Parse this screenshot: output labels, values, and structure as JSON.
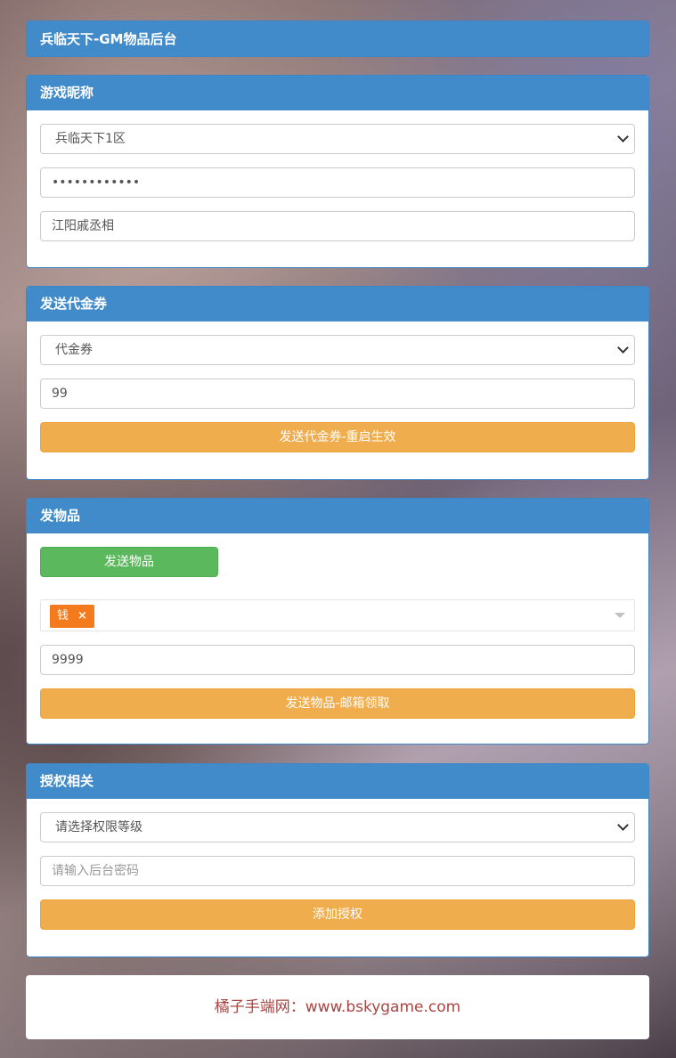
{
  "header": {
    "title": "兵临天下-GM物品后台"
  },
  "nickname_panel": {
    "title": "游戏昵称",
    "server_select": "兵临天下1区",
    "password_value": "••••••••••••",
    "nickname_value": "江阳戚丞相"
  },
  "voucher_panel": {
    "title": "发送代金券",
    "type_select": "代金券",
    "amount_value": "99",
    "send_label": "发送代金券-重启生效"
  },
  "item_panel": {
    "title": "发物品",
    "open_button_label": "发送物品",
    "selected_tag": "钱",
    "tag_remove": "×",
    "quantity_value": "9999",
    "send_label": "发送物品-邮箱领取"
  },
  "auth_panel": {
    "title": "授权相关",
    "level_select": "请选择权限等级",
    "password_placeholder": "请输入后台密码",
    "submit_label": "添加授权"
  },
  "footer": {
    "text": "橘子手端网：www.bskygame.com"
  },
  "colors": {
    "heading": "#428bca",
    "warning": "#f0ad4e",
    "success": "#5cb85c",
    "tag": "#f37b1d",
    "footer_text": "#a94442"
  }
}
